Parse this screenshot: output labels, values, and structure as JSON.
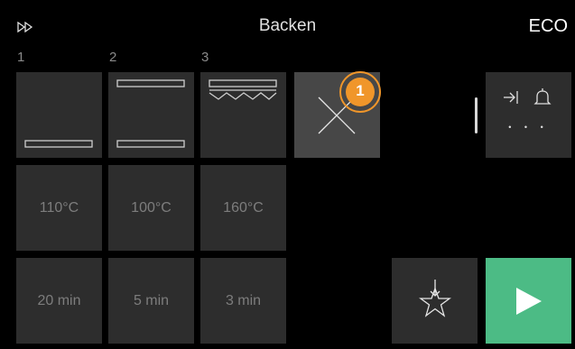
{
  "header": {
    "title": "Backen",
    "eco_label": "ECO",
    "skip_icon": "fast-forward-icon"
  },
  "columns": [
    {
      "number": "1",
      "temperature": "110°C",
      "duration": "20 min"
    },
    {
      "number": "2",
      "temperature": "100°C",
      "duration": "5 min"
    },
    {
      "number": "3",
      "temperature": "160°C",
      "duration": "3 min"
    }
  ],
  "selected_slot": {
    "icon": "close-icon",
    "badge": "1"
  },
  "side_panel": {
    "icons": [
      "arrow-to-end-icon",
      "bell-icon"
    ],
    "more": "• • •"
  },
  "actions": {
    "favorite_icon": "star-add-icon",
    "start_icon": "play-icon"
  },
  "colors": {
    "accent_orange": "#f0962a",
    "start_green": "#4cbb85",
    "tile": "#2d2d2d"
  }
}
